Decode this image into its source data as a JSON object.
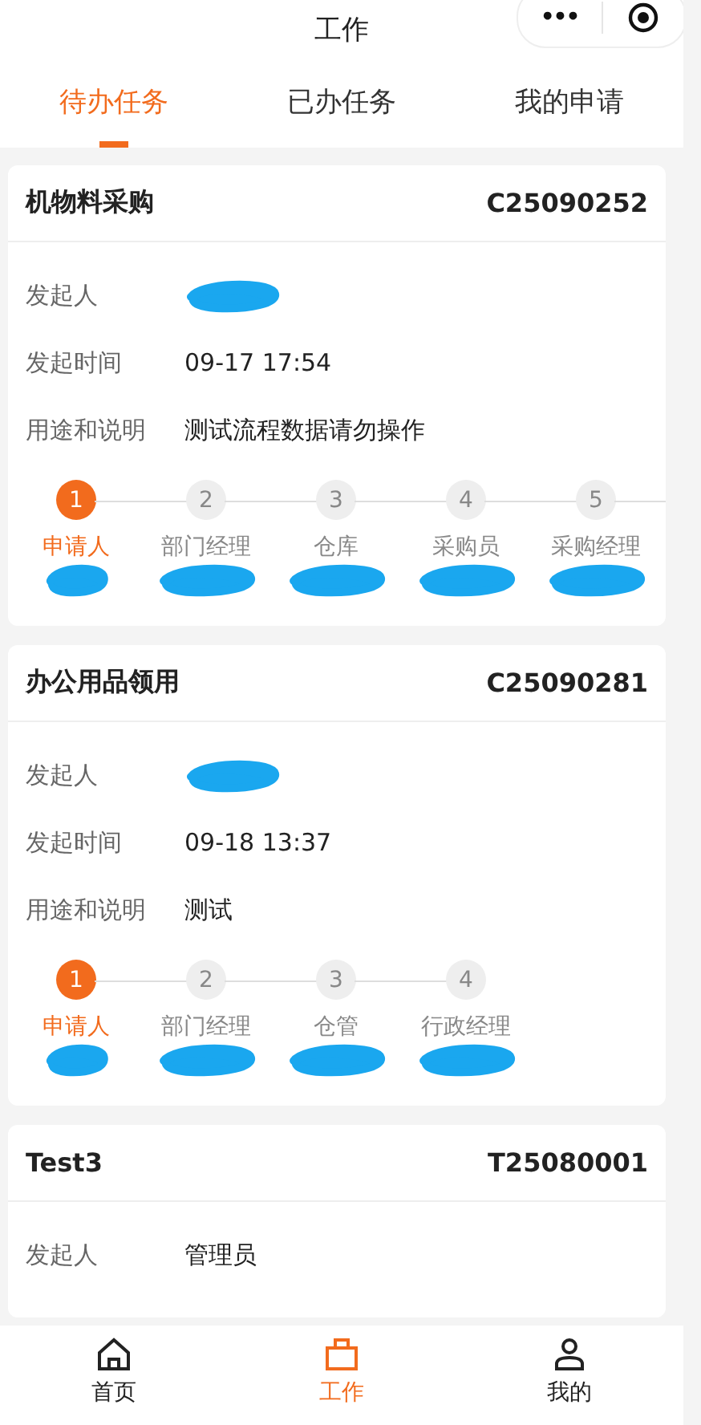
{
  "header": {
    "title": "工作",
    "more_icon": "•••"
  },
  "tabs": [
    {
      "label": "待办任务",
      "selected": true
    },
    {
      "label": "已办任务",
      "selected": false
    },
    {
      "label": "我的申请",
      "selected": false
    }
  ],
  "tasks": [
    {
      "title": "机物料采购",
      "code": "C25090252",
      "fields": [
        {
          "label": "发起人",
          "redacted": true
        },
        {
          "label": "发起时间",
          "value": "09-17 17:54",
          "redacted": false
        },
        {
          "label": "用途和说明",
          "value": "测试流程数据请勿操作",
          "redacted": false
        }
      ],
      "steps_continue": true,
      "steps": [
        {
          "number": "1",
          "role": "申请人",
          "selected": true,
          "redacted": true
        },
        {
          "number": "2",
          "role": "部门经理",
          "selected": false,
          "redacted": true
        },
        {
          "number": "3",
          "role": "仓库",
          "selected": false,
          "redacted": true
        },
        {
          "number": "4",
          "role": "采购员",
          "selected": false,
          "redacted": true
        },
        {
          "number": "5",
          "role": "采购经理",
          "selected": false,
          "redacted": true
        }
      ]
    },
    {
      "title": "办公用品领用",
      "code": "C25090281",
      "fields": [
        {
          "label": "发起人",
          "redacted": true
        },
        {
          "label": "发起时间",
          "value": "09-18 13:37",
          "redacted": false
        },
        {
          "label": "用途和说明",
          "value": "测试",
          "redacted": false
        }
      ],
      "steps_continue": false,
      "steps": [
        {
          "number": "1",
          "role": "申请人",
          "selected": true,
          "redacted": true
        },
        {
          "number": "2",
          "role": "部门经理",
          "selected": false,
          "redacted": true
        },
        {
          "number": "3",
          "role": "仓管",
          "selected": false,
          "redacted": true
        },
        {
          "number": "4",
          "role": "行政经理",
          "selected": false,
          "redacted": true
        }
      ]
    },
    {
      "title": "Test3",
      "code": "T25080001",
      "fields": [
        {
          "label": "发起人",
          "value": "管理员",
          "redacted": false
        }
      ]
    }
  ],
  "nav": [
    {
      "kind": "home",
      "label": "首页",
      "selected": false
    },
    {
      "kind": "work",
      "label": "工作",
      "selected": true
    },
    {
      "kind": "profile",
      "label": "我的",
      "selected": false
    }
  ]
}
